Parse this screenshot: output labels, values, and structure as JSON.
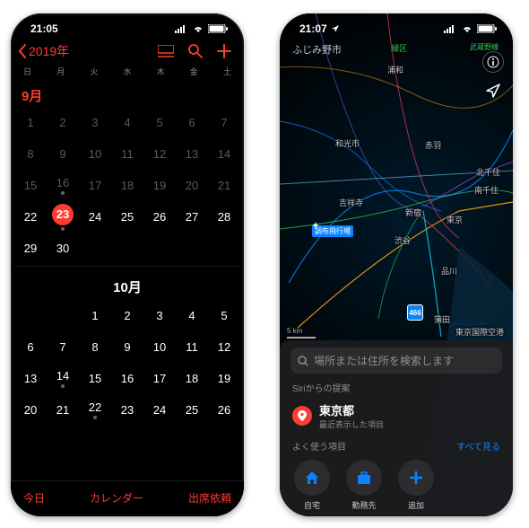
{
  "calendar": {
    "status_time": "21:05",
    "back_label": "2019年",
    "weekdays": [
      "日",
      "月",
      "火",
      "水",
      "木",
      "金",
      "土"
    ],
    "month1_label": "9月",
    "month2_label": "10月",
    "sep_weeks": [
      [
        {
          "n": "1",
          "dim": true
        },
        {
          "n": "2",
          "dim": true
        },
        {
          "n": "3",
          "dim": true
        },
        {
          "n": "4",
          "dim": true
        },
        {
          "n": "5",
          "dim": true
        },
        {
          "n": "6",
          "dim": true
        },
        {
          "n": "7",
          "dim": true
        }
      ],
      [
        {
          "n": "8",
          "dim": true
        },
        {
          "n": "9",
          "dim": true
        },
        {
          "n": "10",
          "dim": true
        },
        {
          "n": "11",
          "dim": true
        },
        {
          "n": "12",
          "dim": true
        },
        {
          "n": "13",
          "dim": true
        },
        {
          "n": "14",
          "dim": true
        }
      ],
      [
        {
          "n": "15",
          "dim": true
        },
        {
          "n": "16",
          "dim": true,
          "dot": true
        },
        {
          "n": "17",
          "dim": true
        },
        {
          "n": "18",
          "dim": true
        },
        {
          "n": "19",
          "dim": true
        },
        {
          "n": "20",
          "dim": true
        },
        {
          "n": "21",
          "dim": true
        }
      ],
      [
        {
          "n": "22"
        },
        {
          "n": "23",
          "today": true,
          "dot": true
        },
        {
          "n": "24"
        },
        {
          "n": "25"
        },
        {
          "n": "26"
        },
        {
          "n": "27"
        },
        {
          "n": "28"
        }
      ],
      [
        {
          "n": "29"
        },
        {
          "n": "30"
        },
        {
          "n": ""
        },
        {
          "n": ""
        },
        {
          "n": ""
        },
        {
          "n": ""
        },
        {
          "n": ""
        }
      ]
    ],
    "oct_weeks": [
      [
        {
          "n": ""
        },
        {
          "n": ""
        },
        {
          "n": "1"
        },
        {
          "n": "2"
        },
        {
          "n": "3"
        },
        {
          "n": "4"
        },
        {
          "n": "5"
        }
      ],
      [
        {
          "n": "6"
        },
        {
          "n": "7"
        },
        {
          "n": "8"
        },
        {
          "n": "9"
        },
        {
          "n": "10"
        },
        {
          "n": "11"
        },
        {
          "n": "12"
        }
      ],
      [
        {
          "n": "13"
        },
        {
          "n": "14",
          "dot": true
        },
        {
          "n": "15"
        },
        {
          "n": "16"
        },
        {
          "n": "17"
        },
        {
          "n": "18"
        },
        {
          "n": "19"
        }
      ],
      [
        {
          "n": "20"
        },
        {
          "n": "21"
        },
        {
          "n": "22",
          "dot": true
        },
        {
          "n": "23"
        },
        {
          "n": "24"
        },
        {
          "n": "25"
        },
        {
          "n": "26"
        }
      ]
    ],
    "footer_today": "今日",
    "footer_center": "カレンダー",
    "footer_right": "出席依頼"
  },
  "maps": {
    "status_time": "21:07",
    "top_city": "ふじみ野市",
    "labels": {
      "midori": "緑区",
      "urawa": "浦和",
      "wako": "和光市",
      "akabane": "赤羽",
      "kitasenju": "北千住",
      "minamisenju": "南千住",
      "kichijoji": "吉祥寺",
      "shinjuku": "新宿",
      "tokyo": "東京",
      "shibuya": "渋谷",
      "shinagawa": "品川",
      "kamata": "蒲田",
      "haneda": "東京国際空港",
      "chofu": "調布飛行場",
      "musashino": "武蔵野線"
    },
    "hwy": "466",
    "search_placeholder": "場所または住所を検索します",
    "siri_heading": "Siriからの提案",
    "siri_title": "東京都",
    "siri_sub": "最近表示した項目",
    "fav_heading": "よく使う項目",
    "fav_link": "すべて見る",
    "fav_home": "自宅",
    "fav_work": "勤務先",
    "fav_add": "追加",
    "scale": "5 km"
  }
}
